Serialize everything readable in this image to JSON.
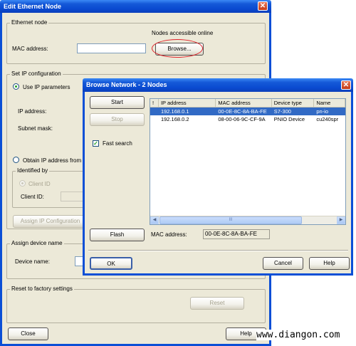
{
  "main_window": {
    "title": "Edit Ethernet Node",
    "ethernet_node": {
      "group_label": "Ethernet node",
      "nodes_online_label": "Nodes accessible online",
      "mac_label": "MAC address:",
      "mac_value": "",
      "browse_label": "Browse..."
    },
    "ip_config": {
      "group_label": "Set IP configuration",
      "use_ip_label": "Use IP parameters",
      "ip_label": "IP address:",
      "subnet_label": "Subnet mask:",
      "obtain_label": "Obtain IP address from a",
      "identified_by_label": "Identified by",
      "client_id_radio": "Client ID",
      "client_id_label": "Client ID:",
      "assign_ip_button": "Assign IP Configuration"
    },
    "device_name": {
      "group_label": "Assign device name",
      "device_label": "Device name:"
    },
    "factory": {
      "group_label": "Reset to factory settings",
      "reset_button": "Reset"
    },
    "close_button": "Close",
    "help_button": "Help"
  },
  "browse_dialog": {
    "title": "Browse Network - 2 Nodes",
    "start_button": "Start",
    "stop_button": "Stop",
    "fast_search_label": "Fast search",
    "fast_search_checked": true,
    "columns": [
      "!",
      "IP address",
      "MAC address",
      "Device type",
      "Name"
    ],
    "rows": [
      {
        "flag": "",
        "ip": "192.168.0.1",
        "mac": "00-0E-8C-8A-BA-FE",
        "type": "S7-300",
        "name": "pn-io",
        "selected": true
      },
      {
        "flag": "",
        "ip": "192.168.0.2",
        "mac": "08-00-06-9C-CF-9A",
        "type": "PNIO Device",
        "name": "cu240spr",
        "selected": false
      }
    ],
    "flash_button": "Flash",
    "mac_label": "MAC address:",
    "mac_value": "00-0E-8C-8A-BA-FE",
    "ok_button": "OK",
    "cancel_button": "Cancel",
    "help_button": "Help",
    "scroll_mark": "III"
  },
  "watermark": "www.diangon.com",
  "colors": {
    "titlebar": "#0a4ad0",
    "window_bg": "#ece9d8",
    "selection": "#316ac5",
    "highlight_ellipse": "#e0222a"
  }
}
